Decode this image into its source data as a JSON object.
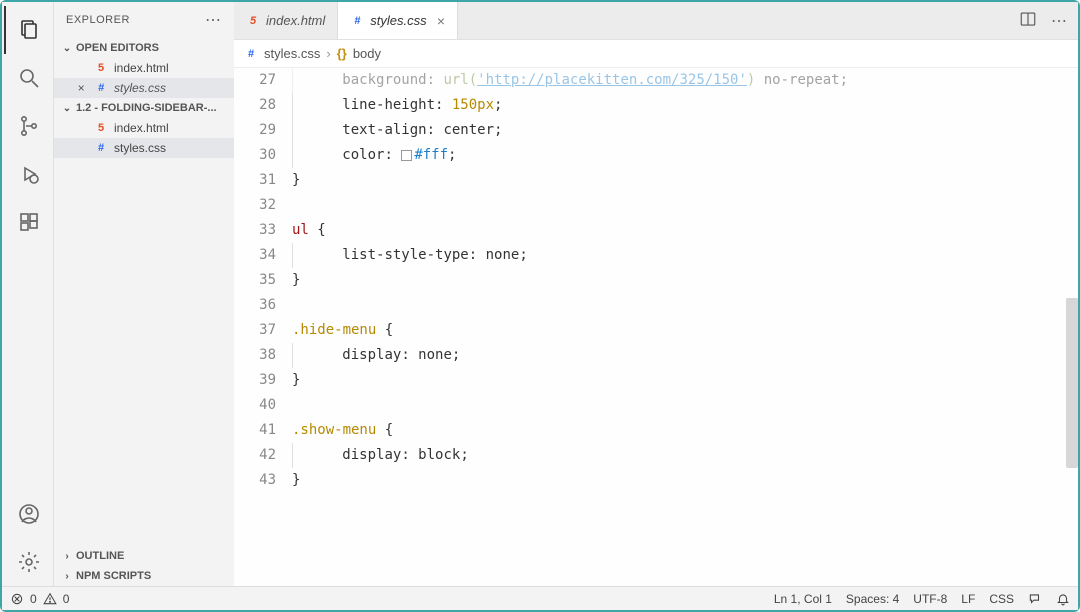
{
  "sidebar": {
    "title": "EXPLORER",
    "sections": {
      "openEditors": {
        "label": "OPEN EDITORS",
        "files": [
          {
            "name": "index.html",
            "type": "html",
            "dirty": false
          },
          {
            "name": "styles.css",
            "type": "css",
            "active": true,
            "dirty": false
          }
        ]
      },
      "folder": {
        "label": "1.2 - FOLDING-SIDEBAR-...",
        "files": [
          {
            "name": "index.html",
            "type": "html"
          },
          {
            "name": "styles.css",
            "type": "css",
            "active": true
          }
        ]
      },
      "outline": {
        "label": "OUTLINE"
      },
      "npmScripts": {
        "label": "NPM SCRIPTS"
      }
    }
  },
  "tabs": [
    {
      "name": "index.html",
      "type": "html",
      "active": false
    },
    {
      "name": "styles.css",
      "type": "css",
      "active": true
    }
  ],
  "breadcrumb": {
    "file": "styles.css",
    "symbol": "body"
  },
  "code": {
    "startLine": 27,
    "lines": [
      {
        "n": 27,
        "segs": [
          [
            "pad",
            "   "
          ],
          [
            "prop",
            "background"
          ],
          [
            "p",
            ": "
          ],
          [
            "fn",
            "url("
          ],
          [
            "url",
            "'http://placekitten.com/325/150'"
          ],
          [
            "fn",
            ") "
          ],
          [
            "prop",
            "no-repeat"
          ],
          [
            "p",
            ";"
          ]
        ],
        "faded": true
      },
      {
        "n": 28,
        "segs": [
          [
            "pad",
            "   "
          ],
          [
            "prop",
            "line-height"
          ],
          [
            "p",
            ": "
          ],
          [
            "num",
            "150px"
          ],
          [
            "p",
            ";"
          ]
        ]
      },
      {
        "n": 29,
        "segs": [
          [
            "pad",
            "   "
          ],
          [
            "prop",
            "text-align"
          ],
          [
            "p",
            ": "
          ],
          [
            "val",
            "center"
          ],
          [
            "p",
            ";"
          ]
        ]
      },
      {
        "n": 30,
        "segs": [
          [
            "pad",
            "   "
          ],
          [
            "prop",
            "color"
          ],
          [
            "p",
            ": "
          ],
          [
            "swatch",
            "#fff"
          ],
          [
            "hex",
            "#fff"
          ],
          [
            "p",
            ";"
          ]
        ]
      },
      {
        "n": 31,
        "segs": [
          [
            "p",
            "}"
          ]
        ]
      },
      {
        "n": 32,
        "segs": []
      },
      {
        "n": 33,
        "segs": [
          [
            "sel",
            "ul"
          ],
          [
            "p",
            " {"
          ]
        ]
      },
      {
        "n": 34,
        "segs": [
          [
            "pad",
            "   "
          ],
          [
            "prop",
            "list-style-type"
          ],
          [
            "p",
            ": "
          ],
          [
            "val",
            "none"
          ],
          [
            "p",
            ";"
          ]
        ]
      },
      {
        "n": 35,
        "segs": [
          [
            "p",
            "}"
          ]
        ]
      },
      {
        "n": 36,
        "segs": []
      },
      {
        "n": 37,
        "segs": [
          [
            "class",
            ".hide-menu"
          ],
          [
            "p",
            " {"
          ]
        ]
      },
      {
        "n": 38,
        "segs": [
          [
            "pad",
            "   "
          ],
          [
            "prop",
            "display"
          ],
          [
            "p",
            ": "
          ],
          [
            "val",
            "none"
          ],
          [
            "p",
            ";"
          ]
        ]
      },
      {
        "n": 39,
        "segs": [
          [
            "p",
            "}"
          ]
        ]
      },
      {
        "n": 40,
        "segs": []
      },
      {
        "n": 41,
        "segs": [
          [
            "class",
            ".show-menu"
          ],
          [
            "p",
            " {"
          ]
        ]
      },
      {
        "n": 42,
        "segs": [
          [
            "pad",
            "   "
          ],
          [
            "prop",
            "display"
          ],
          [
            "p",
            ": "
          ],
          [
            "val",
            "block"
          ],
          [
            "p",
            ";"
          ]
        ]
      },
      {
        "n": 43,
        "segs": [
          [
            "p",
            "}"
          ]
        ]
      }
    ]
  },
  "status": {
    "errors": "0",
    "warnings": "0",
    "lncol": "Ln 1, Col 1",
    "spaces": "Spaces: 4",
    "encoding": "UTF-8",
    "eol": "LF",
    "lang": "CSS"
  }
}
